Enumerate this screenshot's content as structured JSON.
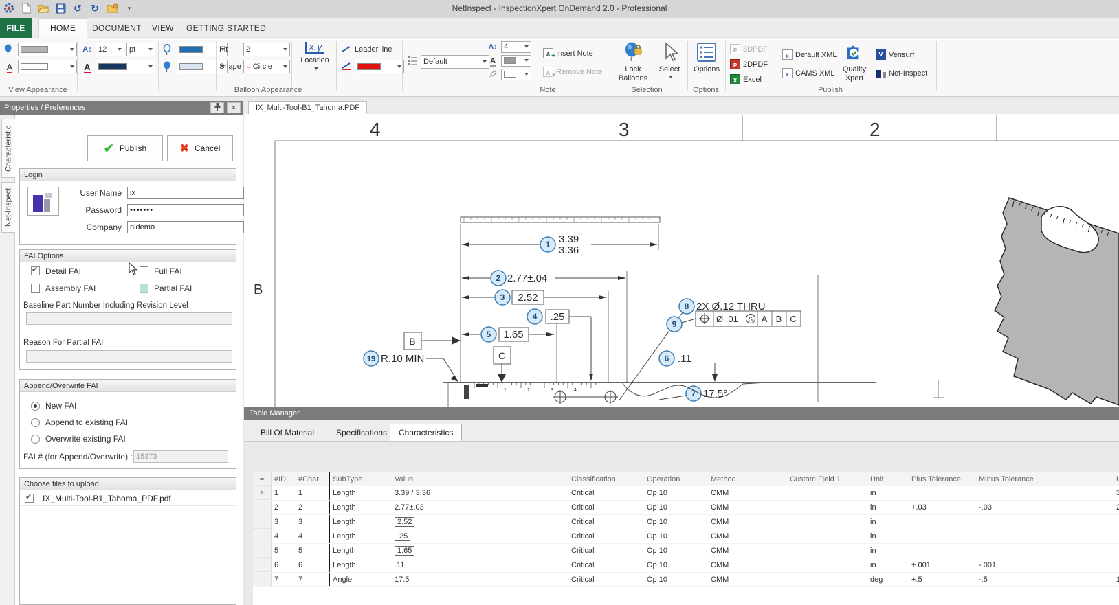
{
  "window": {
    "title": "NetInspect - InspectionXpert OnDemand 2.0 - Professional"
  },
  "quick_access": {
    "icons": [
      "app-icon",
      "new-document-icon",
      "open-icon",
      "save-icon",
      "undo-icon",
      "redo-icon",
      "new-folder-icon",
      "customize-icon"
    ]
  },
  "ribbon": {
    "tabs": [
      {
        "label": "FILE"
      },
      {
        "label": "HOME"
      },
      {
        "label": "DOCUMENT"
      },
      {
        "label": "VIEW"
      },
      {
        "label": "GETTING STARTED"
      }
    ],
    "group_labels": [
      "View Appearance",
      "Balloon Appearance",
      "Note",
      "Selection",
      "Options",
      "Publish"
    ],
    "colors": {
      "view_swatch1": "#b3b3b3",
      "view_swatch2": "#fdfdff",
      "font_color": "#17365d",
      "balloon_outline": "#1f6fb5",
      "balloon_fill": "#dbe5f1",
      "leader_red": "#e01212",
      "note_font": "#9a9a9a",
      "note_fill": "#ffffff"
    },
    "font": {
      "size": "12",
      "unit": "pt"
    },
    "fit": {
      "label": "Fit",
      "value": "2"
    },
    "shape": {
      "label": "Shape",
      "value": "Circle"
    },
    "location": {
      "icon_text": "x.y",
      "label": "Location"
    },
    "leader": {
      "label": "Leader line"
    },
    "style": {
      "value": "Default"
    },
    "note": {
      "size": "4",
      "insert": "Insert Note",
      "remove": "Remove Note"
    },
    "selection": {
      "lock": "Lock Balloons",
      "select": "Select"
    },
    "options_label": "Options",
    "publish": {
      "pdf3d": "3DPDF",
      "pdf2d": "2DPDF",
      "excel": "Excel",
      "default_xml": "Default XML",
      "cams_xml": "CAMS XML",
      "quality": "Quality Xpert",
      "verisurf": "Verisurf",
      "netinspect": "Net-Inspect"
    }
  },
  "properties_panel": {
    "title": "Properties / Preferences",
    "side_tabs": [
      {
        "label": "Characteristic"
      },
      {
        "label": "Net-Inspect"
      }
    ],
    "publish_button": "Publish",
    "cancel_button": "Cancel",
    "login": {
      "title": "Login",
      "user_label": "User Name",
      "user_value": "ix",
      "password_label": "Password",
      "password_value": "•••••••",
      "company_label": "Company",
      "company_value": "nidemo"
    },
    "fai": {
      "title": "FAI Options",
      "detail": "Detail FAI",
      "full": "Full FAI",
      "assembly": "Assembly FAI",
      "partial": "Partial FAI",
      "baseline_label": "Baseline Part Number Including Revision Level",
      "reason_label": "Reason For Partial FAI"
    },
    "append": {
      "title": "Append/Overwrite FAI",
      "new": "New FAI",
      "append": "Append to existing FAI",
      "overwrite": "Overwrite existing FAI",
      "fai_num_label": "FAI # (for Append/Overwrite) :",
      "fai_num_value": "15373"
    },
    "files": {
      "title": "Choose files to upload",
      "file_name": "IX_Multi-Tool-B1_Tahoma_PDF.pdf"
    }
  },
  "document": {
    "tab": "IX_Multi-Tool-B1_Tahoma.PDF",
    "zones": [
      "4",
      "3",
      "2"
    ],
    "row_label": "B",
    "drawing": {
      "balloons": {
        "b1": "1",
        "b2": "2",
        "b3": "3",
        "b4": "4",
        "b5": "5",
        "b6": "6",
        "b7": "7",
        "b8": "8",
        "b9": "9",
        "b19": "19"
      },
      "dim1_upper": "3.39",
      "dim1_lower": "3.36",
      "dim2": "2.77±.04",
      "dim3": "2.52",
      "dim4": ".25",
      "dim5": "1.65",
      "dim6": ".11",
      "dim7": "17.5°",
      "dim8": "2X Ø.12 THRU",
      "dim19": "R.10 MIN",
      "datum_b": "B",
      "datum_c": "C",
      "fcf": {
        "tolerance": "Ø .01",
        "modifier": "S",
        "datum1": "A",
        "datum2": "B",
        "datum3": "C"
      },
      "ruler_numbers": [
        "1",
        "2",
        "3",
        "4"
      ]
    }
  },
  "table_manager": {
    "title": "Table Manager",
    "tabs": [
      {
        "label": "Bill Of Material"
      },
      {
        "label": "Specifications"
      },
      {
        "label": "Characteristics"
      }
    ],
    "columns": [
      "#ID",
      "#Char",
      "SubType",
      "Value",
      "Classification",
      "Operation",
      "Method",
      "Custom Field 1",
      "Unit",
      "Plus Tolerance",
      "Minus Tolerance",
      "U"
    ],
    "rows": [
      {
        "id": "1",
        "char": "1",
        "subtype": "Length",
        "value": "3.39 / 3.36",
        "boxed": false,
        "classification": "Critical",
        "operation": "Op 10",
        "method": "CMM",
        "custom_field": "",
        "unit": "in",
        "plus": "",
        "minus": "",
        "last": "3",
        "selected": true
      },
      {
        "id": "2",
        "char": "2",
        "subtype": "Length",
        "value": "2.77±.03",
        "boxed": false,
        "classification": "Critical",
        "operation": "Op 10",
        "method": "CMM",
        "custom_field": "",
        "unit": "in",
        "plus": "+.03",
        "minus": "-.03",
        "last": "2",
        "selected": false
      },
      {
        "id": "3",
        "char": "3",
        "subtype": "Length",
        "value": "2.52",
        "boxed": true,
        "classification": "Critical",
        "operation": "Op 10",
        "method": "CMM",
        "custom_field": "",
        "unit": "in",
        "plus": "",
        "minus": "",
        "last": "",
        "selected": false
      },
      {
        "id": "4",
        "char": "4",
        "subtype": "Length",
        "value": ".25",
        "boxed": true,
        "classification": "Critical",
        "operation": "Op 10",
        "method": "CMM",
        "custom_field": "",
        "unit": "in",
        "plus": "",
        "minus": "",
        "last": "",
        "selected": false
      },
      {
        "id": "5",
        "char": "5",
        "subtype": "Length",
        "value": "1.65",
        "boxed": true,
        "classification": "Critical",
        "operation": "Op 10",
        "method": "CMM",
        "custom_field": "",
        "unit": "in",
        "plus": "",
        "minus": "",
        "last": "",
        "selected": false
      },
      {
        "id": "6",
        "char": "6",
        "subtype": "Length",
        "value": ".11",
        "boxed": false,
        "classification": "Critical",
        "operation": "Op 10",
        "method": "CMM",
        "custom_field": "",
        "unit": "in",
        "plus": "+.001",
        "minus": "-.001",
        "last": ".",
        "selected": false
      },
      {
        "id": "7",
        "char": "7",
        "subtype": "Angle",
        "value": "17.5",
        "boxed": false,
        "classification": "Critical",
        "operation": "Op 10",
        "method": "CMM",
        "custom_field": "",
        "unit": "deg",
        "plus": "+.5",
        "minus": "-.5",
        "last": "1",
        "selected": false
      }
    ]
  }
}
